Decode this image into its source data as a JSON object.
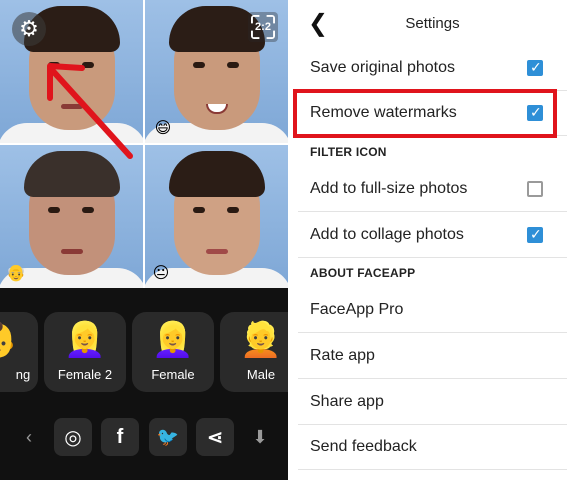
{
  "photo_panel": {
    "ratio_label": "2:2",
    "tiles": [
      {
        "name": "original",
        "emoji": ""
      },
      {
        "name": "smile",
        "emoji": "😄"
      },
      {
        "name": "old",
        "emoji": "👴"
      },
      {
        "name": "female",
        "emoji": "😐"
      }
    ]
  },
  "filters": [
    {
      "label": "ng",
      "emoji": "👶"
    },
    {
      "label": "Female 2",
      "emoji": "👱‍♀️"
    },
    {
      "label": "Female",
      "emoji": "👱‍♀️"
    },
    {
      "label": "Male",
      "emoji": "👱"
    }
  ],
  "toolbar": {
    "prev_glyph": "‹",
    "instagram": "◎",
    "facebook": "f",
    "twitter": "🐦",
    "share": "⋖",
    "download": "⬇"
  },
  "settings": {
    "title": "Settings",
    "back_glyph": "❮",
    "items": [
      {
        "label": "Save original photos",
        "checked": true
      },
      {
        "label": "Remove watermarks",
        "checked": true
      }
    ],
    "section_filter": "FILTER ICON",
    "filter_items": [
      {
        "label": "Add to full-size photos",
        "checked": false
      },
      {
        "label": "Add to collage photos",
        "checked": true
      }
    ],
    "section_about": "ABOUT FACEAPP",
    "about_items": [
      {
        "label": "FaceApp Pro"
      },
      {
        "label": "Rate app"
      },
      {
        "label": "Share app"
      },
      {
        "label": "Send feedback"
      }
    ]
  },
  "colors": {
    "highlight": "#e0141c",
    "checkbox_blue": "#2e8fd7",
    "arrow_red": "#e0141c"
  }
}
